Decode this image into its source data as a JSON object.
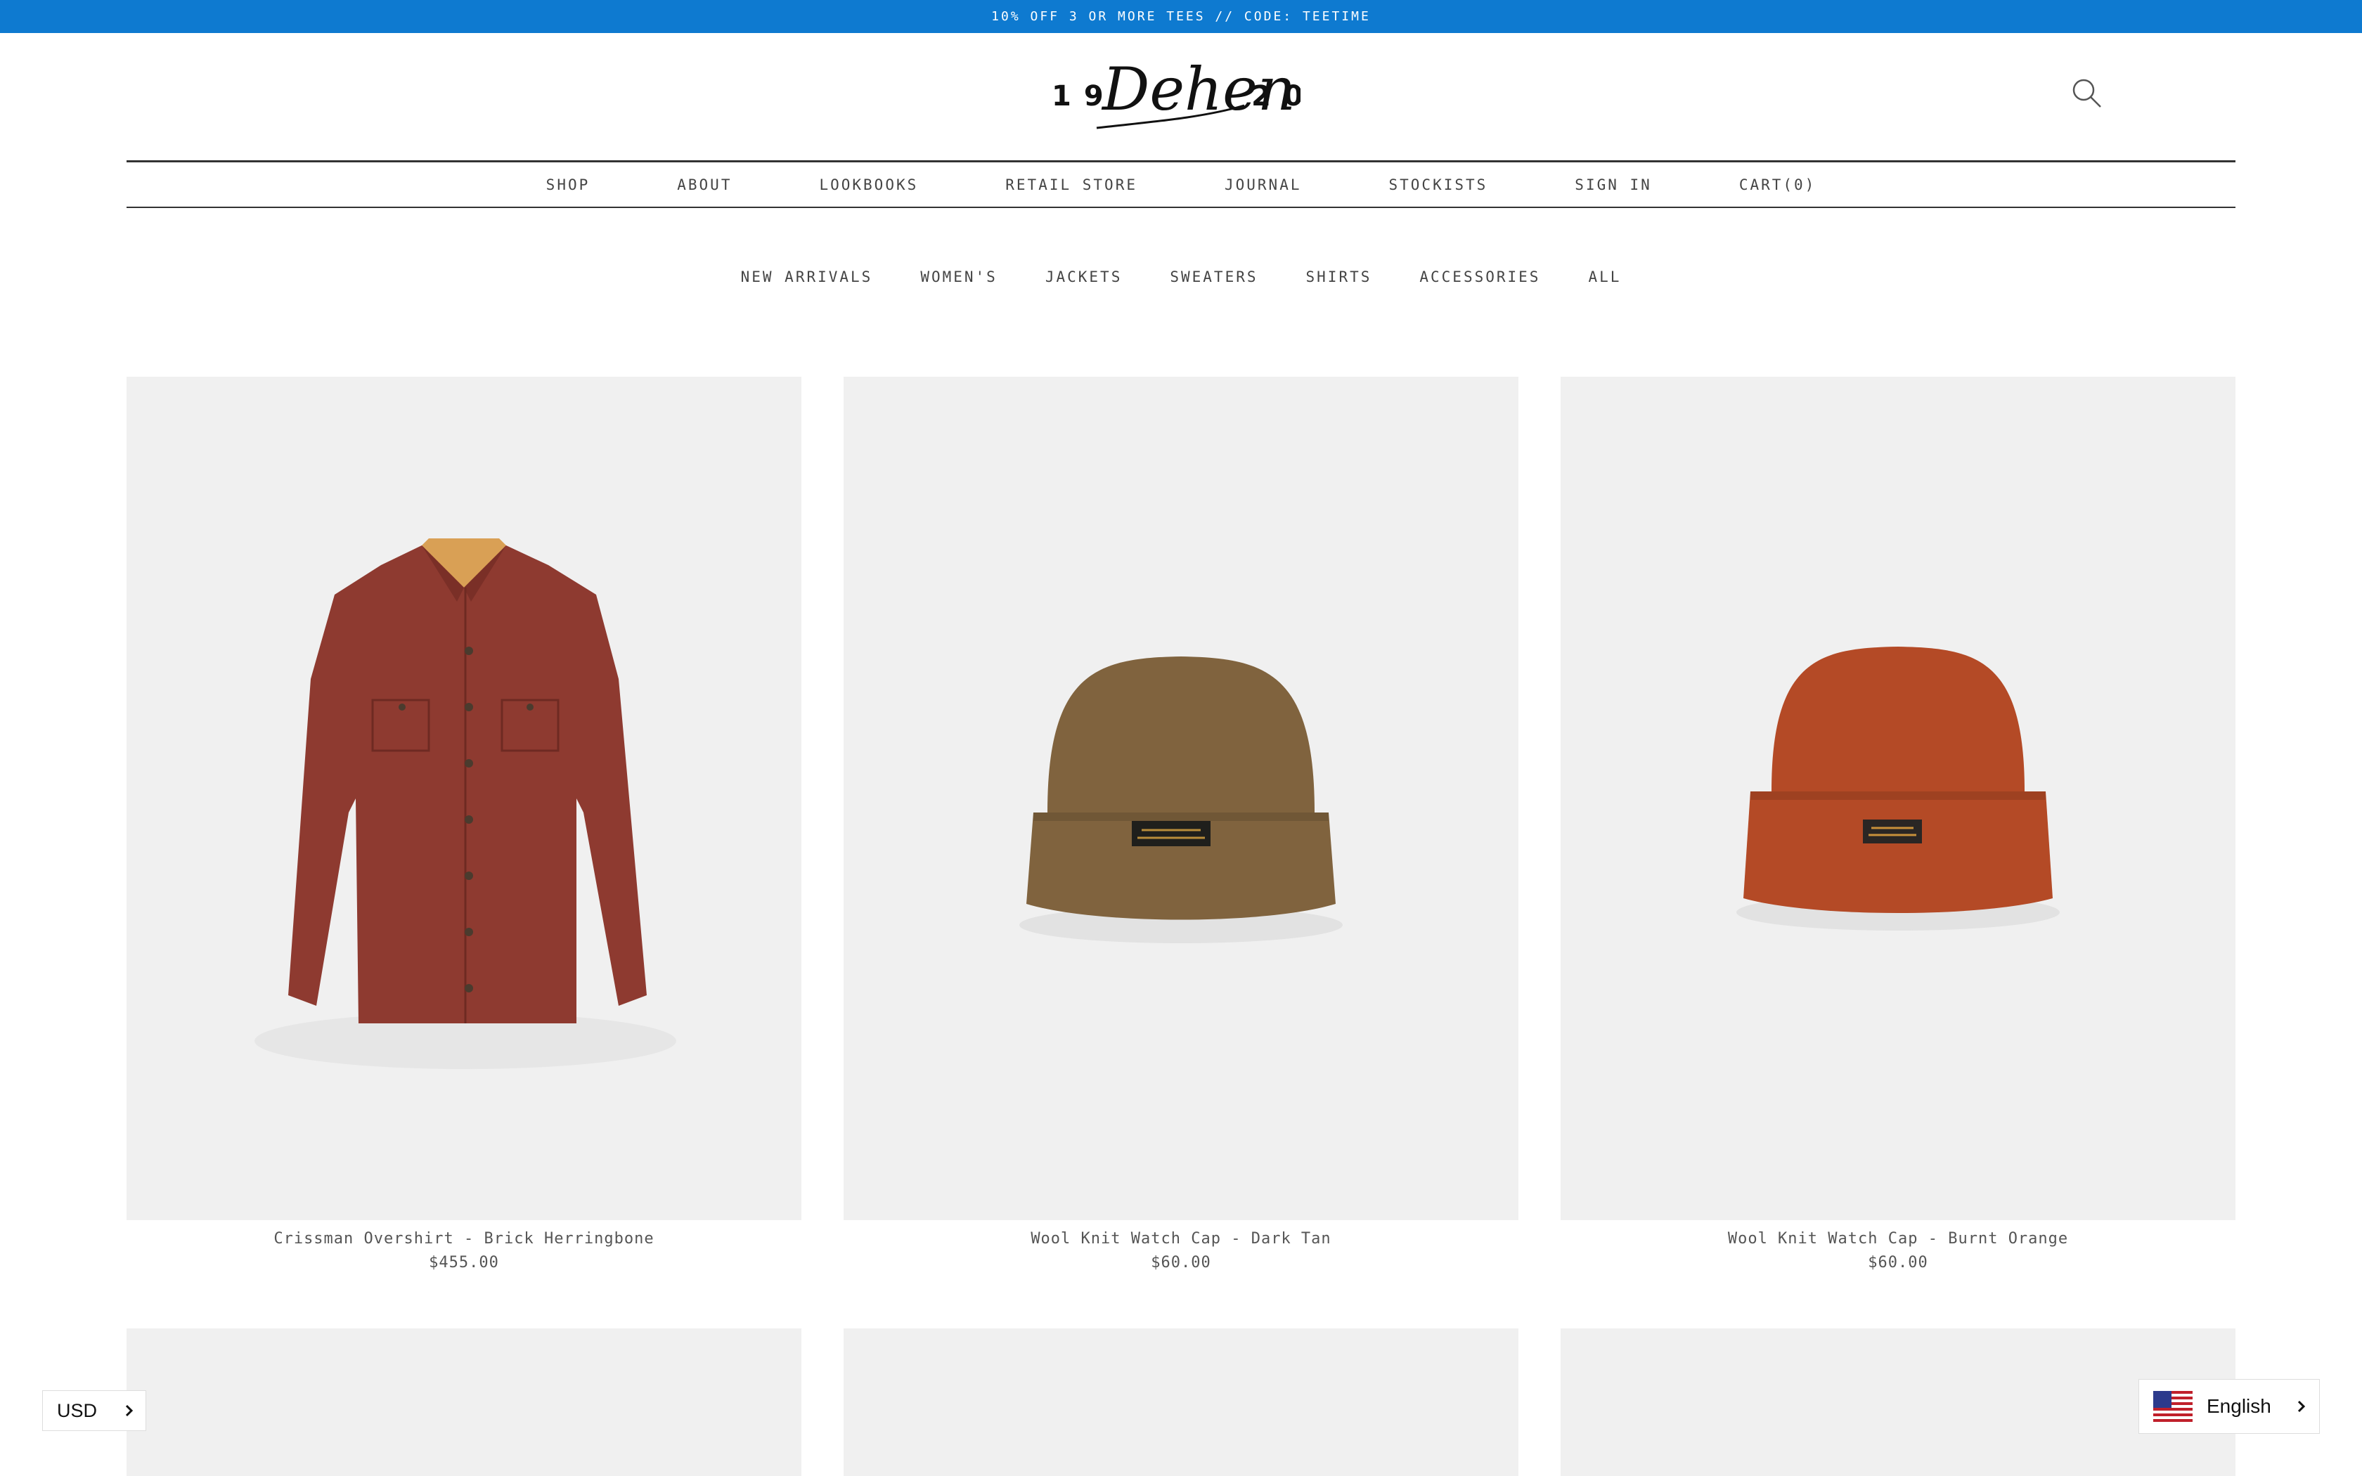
{
  "announcement": "10% OFF 3 OR MORE TEES // CODE: TEETIME",
  "logo": {
    "left": "19",
    "script": "Dehen",
    "right": "20"
  },
  "main_nav": [
    "SHOP",
    "ABOUT",
    "LOOKBOOKS",
    "RETAIL STORE",
    "JOURNAL",
    "STOCKISTS",
    "SIGN IN",
    "CART(0)"
  ],
  "sub_nav": [
    "NEW ARRIVALS",
    "WOMEN'S",
    "JACKETS",
    "SWEATERS",
    "SHIRTS",
    "ACCESSORIES",
    "ALL"
  ],
  "products": [
    {
      "title": "Crissman Overshirt - Brick Herringbone",
      "price": "$455.00",
      "color": "#8e3a30"
    },
    {
      "title": "Wool Knit Watch Cap - Dark Tan",
      "price": "$60.00",
      "color": "#80633e"
    },
    {
      "title": "Wool Knit Watch Cap - Burnt Orange",
      "price": "$60.00",
      "color": "#b44a26"
    }
  ],
  "currency": {
    "label": "USD"
  },
  "language": {
    "label": "English"
  },
  "colors": {
    "announce_bg": "#0e7ad0",
    "image_bg": "#f0f0f0"
  }
}
